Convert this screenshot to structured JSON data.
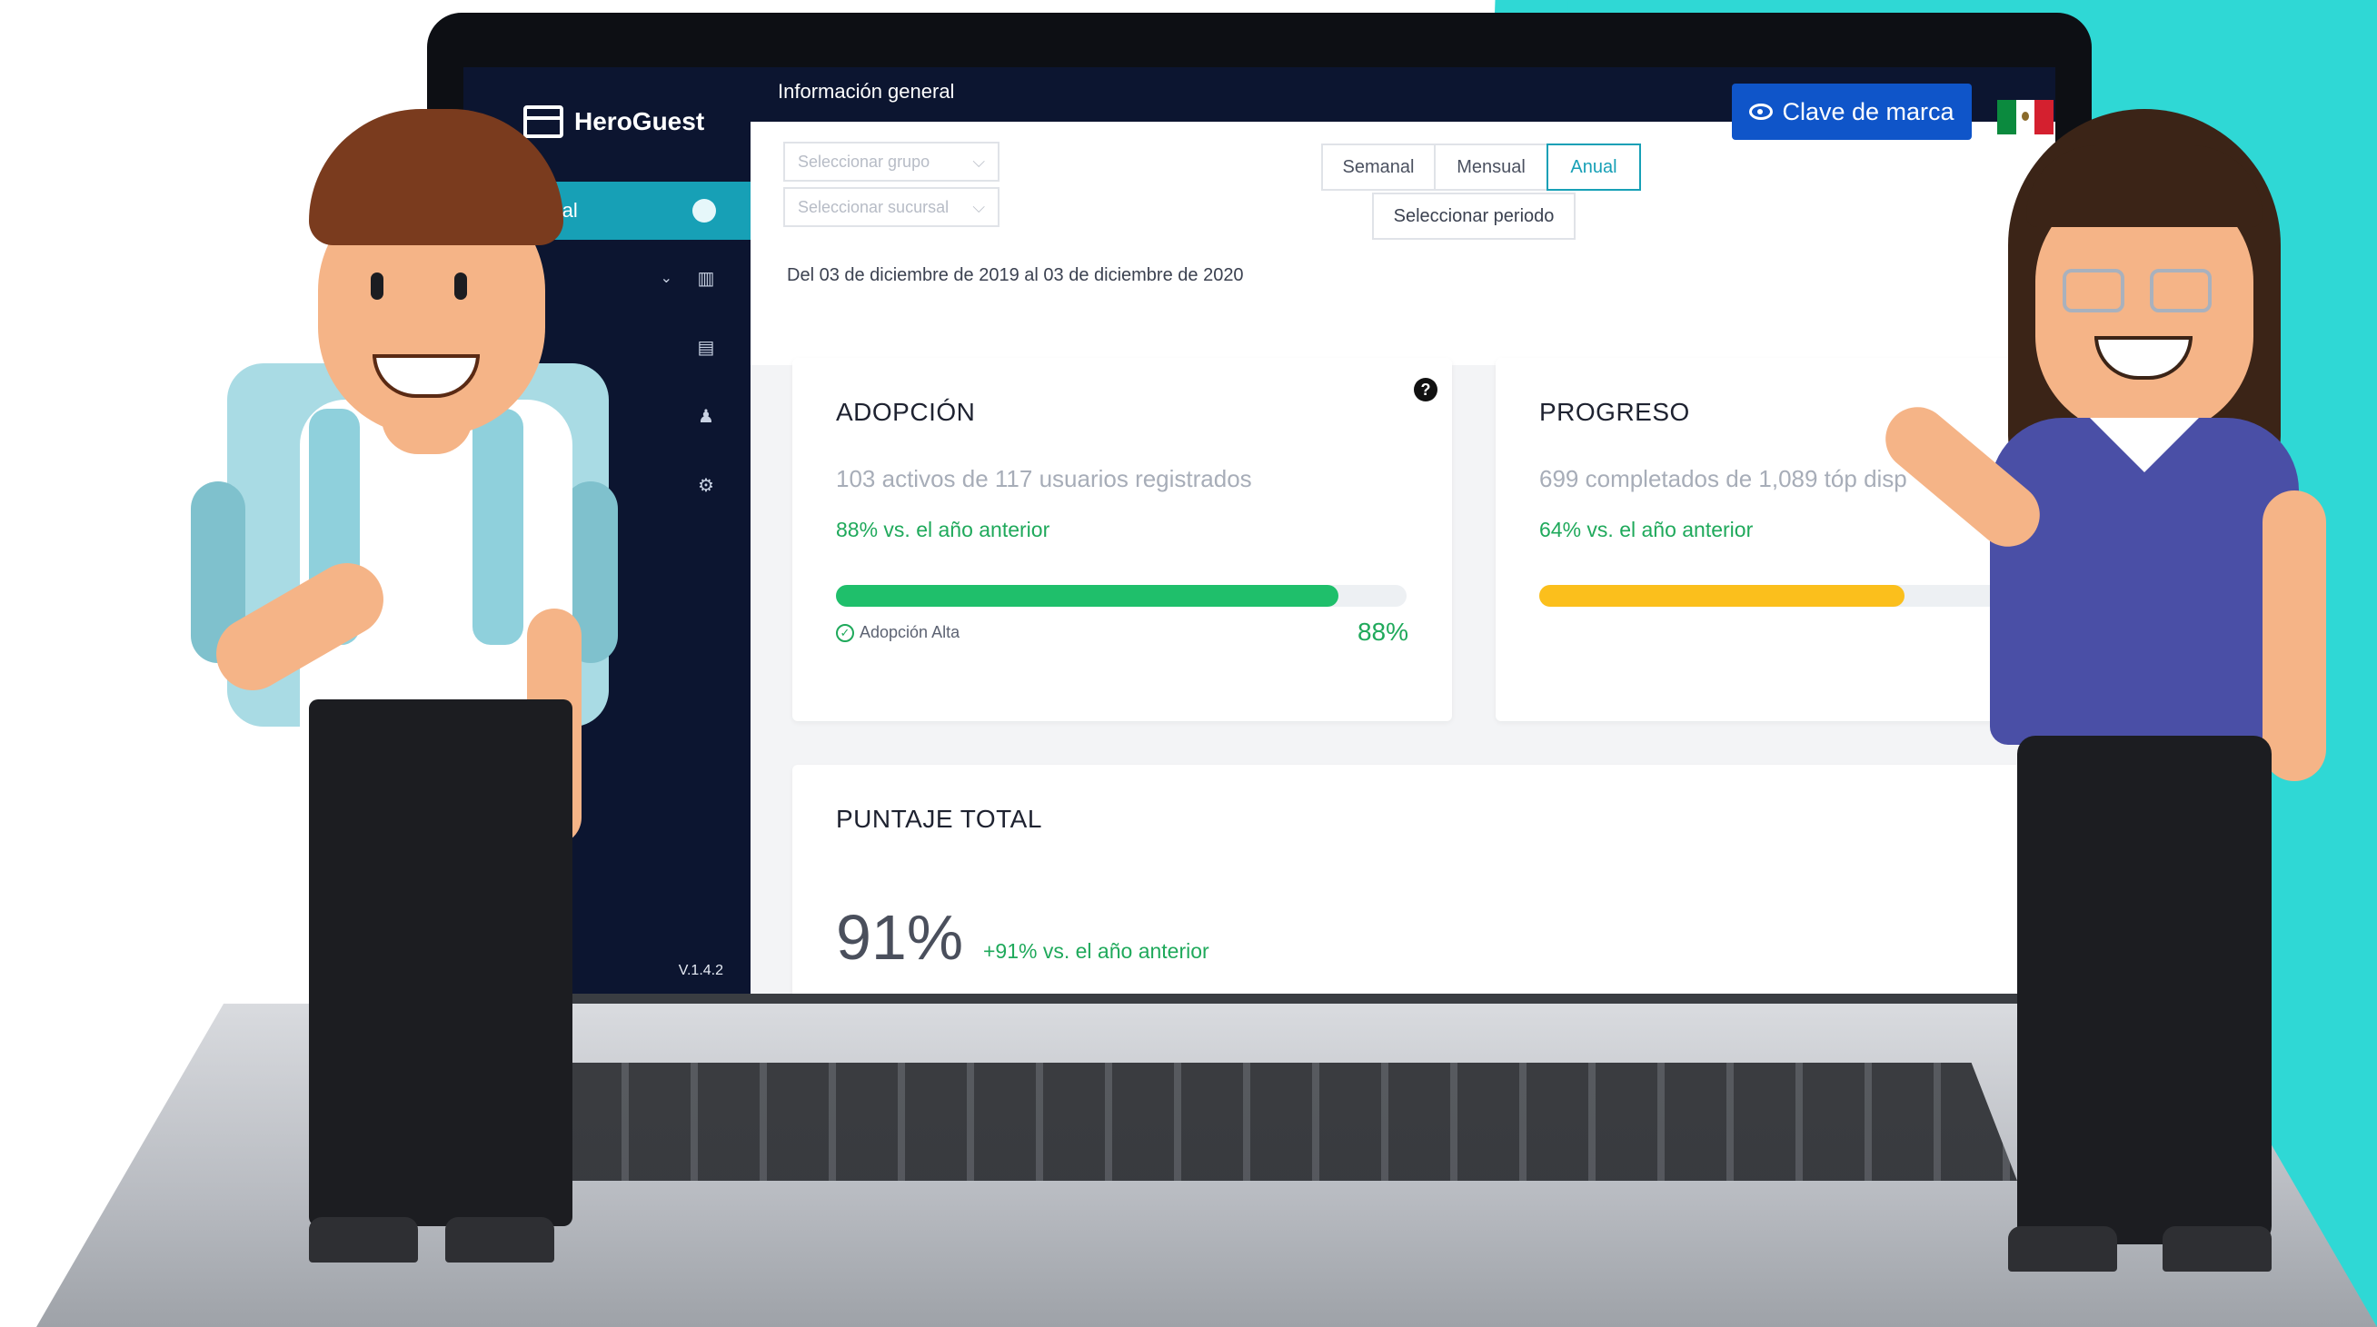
{
  "sidebar": {
    "brand": "HeroGuest",
    "active_item": "n general",
    "version": "V.1.4.2"
  },
  "header": {
    "title": "Información general",
    "brand_key_button": "Clave de marca"
  },
  "filters": {
    "group_placeholder": "Seleccionar grupo",
    "branch_placeholder": "Seleccionar sucursal",
    "periods": [
      "Semanal",
      "Mensual",
      "Anual"
    ],
    "active_period": "Anual",
    "select_period": "Seleccionar periodo",
    "date_range": "Del 03 de diciembre de 2019 al 03 de diciembre de 2020"
  },
  "adoption": {
    "title": "ADOPCIÓN",
    "summary": "103 activos de 117 usuarios registrados",
    "trend": "88% vs. el año anterior",
    "progress": 0.88,
    "bar_color": "#1fbf6b",
    "badge": "Adopción Alta",
    "percent": "88%",
    "help": "?"
  },
  "progress": {
    "title": "PROGRESO",
    "summary": "699 completados de 1,089 tóp",
    "summary_tail": "disp",
    "trend": "64% vs. el año anterior",
    "progress": 0.64,
    "bar_color": "#fbbf1c"
  },
  "total": {
    "title": "PUNTAJE TOTAL",
    "value": "91%",
    "trend": "+91% vs. el año anterior"
  },
  "colors": {
    "accent": "#17a0b6",
    "sidebar": "#0c1530",
    "brand_button": "#0f55c9",
    "positive": "#1fa95b",
    "background_accent": "#2fd8d5"
  }
}
